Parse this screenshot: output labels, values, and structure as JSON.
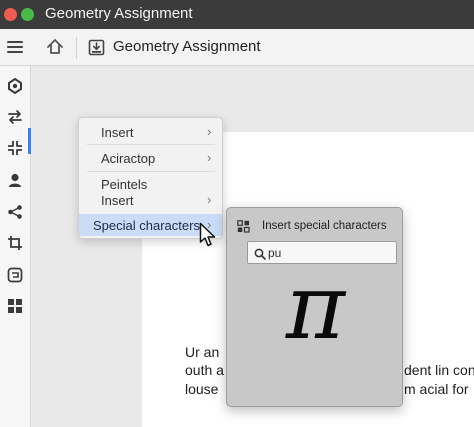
{
  "window": {
    "title": "Geometry Assignment"
  },
  "toolbar": {
    "document_title": "Geometry Assignment"
  },
  "rail": {
    "icons": [
      "navigate-icon",
      "swap-icon",
      "compress-icon",
      "user-icon",
      "share-icon",
      "crop-icon",
      "translate-icon",
      "grid-icon"
    ],
    "active_index": 2,
    "accent": "#3d7ff0"
  },
  "context_menu": {
    "items": [
      {
        "label": "Insert",
        "has_submenu": true
      },
      {
        "label": "Aciractop",
        "has_submenu": true
      },
      {
        "label": "Peintels",
        "has_submenu": false
      },
      {
        "label": "Insert",
        "has_submenu": true
      },
      {
        "label": "Special characters",
        "has_submenu": true,
        "highlighted": true
      }
    ],
    "submenu_chevron": "›"
  },
  "special_panel": {
    "title": "Insert special characters",
    "search_value": "pu",
    "search_placeholder": "",
    "glyph": "π"
  },
  "document": {
    "lines": [
      "Ur an",
      "outh a",
      "dent lin con",
      "louse",
      "m acial for"
    ]
  },
  "colors": {
    "titlebar": "#3b3b3b",
    "menu_highlight": "#cadcf7",
    "panel_bg": "#c8c8c8"
  }
}
